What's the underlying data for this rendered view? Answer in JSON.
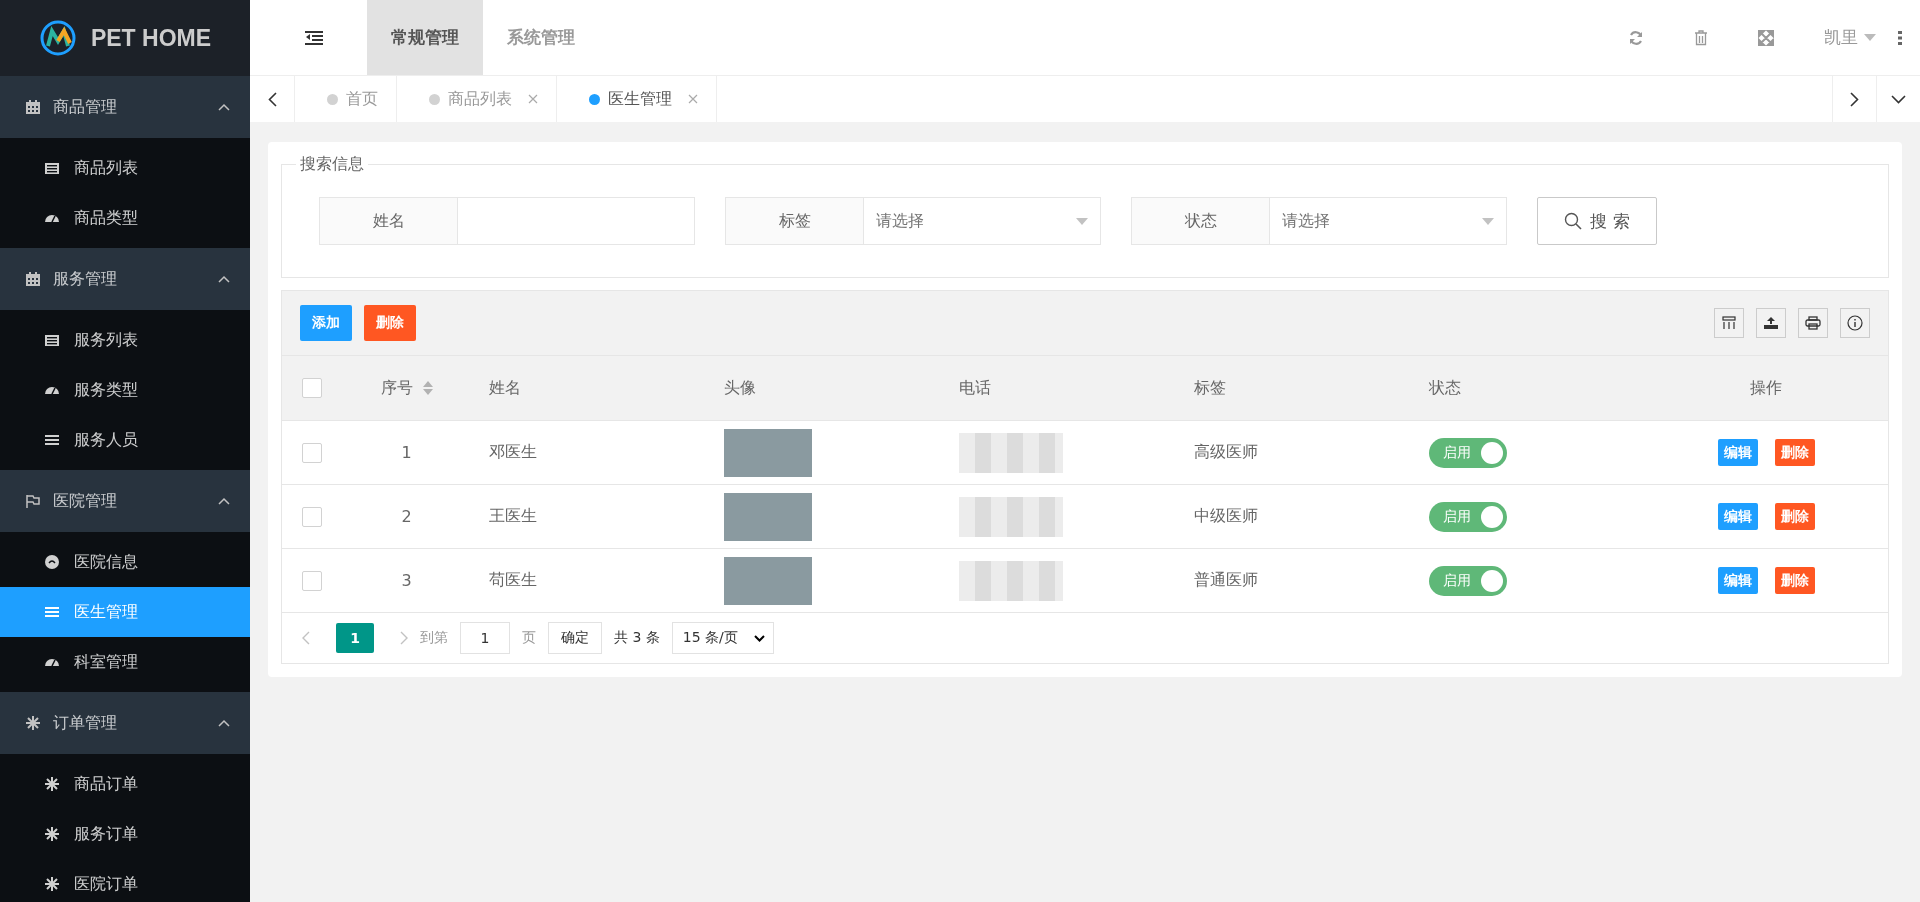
{
  "logo": {
    "title": "PET HOME"
  },
  "sidebar": {
    "groups": [
      {
        "label": "商品管理",
        "kind": "calendar",
        "expanded": true,
        "items": [
          {
            "label": "商品列表",
            "kind": "list",
            "selected": false
          },
          {
            "label": "商品类型",
            "kind": "gauge",
            "selected": false
          }
        ]
      },
      {
        "label": "服务管理",
        "kind": "calendar",
        "expanded": true,
        "items": [
          {
            "label": "服务列表",
            "kind": "list",
            "selected": false
          },
          {
            "label": "服务类型",
            "kind": "gauge",
            "selected": false
          },
          {
            "label": "服务人员",
            "kind": "bars",
            "selected": false
          }
        ]
      },
      {
        "label": "医院管理",
        "kind": "flag",
        "expanded": true,
        "items": [
          {
            "label": "医院信息",
            "kind": "dot",
            "selected": false
          },
          {
            "label": "医生管理",
            "kind": "bars",
            "selected": true
          },
          {
            "label": "科室管理",
            "kind": "gauge",
            "selected": false
          }
        ]
      },
      {
        "label": "订单管理",
        "kind": "snow",
        "expanded": true,
        "items": [
          {
            "label": "商品订单",
            "kind": "snow",
            "selected": false
          },
          {
            "label": "服务订单",
            "kind": "snow",
            "selected": false
          },
          {
            "label": "医院订单",
            "kind": "snow",
            "selected": false
          }
        ]
      }
    ]
  },
  "header": {
    "menu": [
      {
        "label": "常规管理",
        "selected": true
      },
      {
        "label": "系统管理",
        "selected": false
      }
    ],
    "user": "凯里"
  },
  "tabs": [
    {
      "label": "首页",
      "selected": false,
      "closable": false
    },
    {
      "label": "商品列表",
      "selected": false,
      "closable": true
    },
    {
      "label": "医生管理",
      "selected": true,
      "closable": true
    }
  ],
  "search": {
    "legend": "搜索信息",
    "fields": [
      {
        "label": "姓名",
        "kind": "text"
      },
      {
        "label": "标签",
        "kind": "select",
        "placeholder": "请选择"
      },
      {
        "label": "状态",
        "kind": "select",
        "placeholder": "请选择"
      }
    ],
    "button": "搜 索"
  },
  "toolbar": {
    "buttons": [
      {
        "label": "添加",
        "kind": "primary"
      },
      {
        "label": "删除",
        "kind": "danger"
      }
    ]
  },
  "table": {
    "header_checked": false,
    "columns": [
      {
        "label": "序号",
        "sortable": true
      },
      {
        "label": "姓名",
        "sortable": false
      },
      {
        "label": "头像",
        "sortable": false
      },
      {
        "label": "电话",
        "sortable": false
      },
      {
        "label": "标签",
        "sortable": false
      },
      {
        "label": "状态",
        "sortable": false
      },
      {
        "label": "操作",
        "sortable": false
      }
    ],
    "rows": [
      {
        "checked": false,
        "index": "1",
        "name": "邓医生",
        "label": "高级医师",
        "status": {
          "label": "启用",
          "on": true
        },
        "actions": [
          {
            "label": "编辑",
            "kind": "primary"
          },
          {
            "label": "删除",
            "kind": "danger"
          }
        ]
      },
      {
        "checked": false,
        "index": "2",
        "name": "王医生",
        "label": "中级医师",
        "status": {
          "label": "启用",
          "on": true
        },
        "actions": [
          {
            "label": "编辑",
            "kind": "primary"
          },
          {
            "label": "删除",
            "kind": "danger"
          }
        ]
      },
      {
        "checked": false,
        "index": "3",
        "name": "苟医生",
        "label": "普通医师",
        "status": {
          "label": "启用",
          "on": true
        },
        "actions": [
          {
            "label": "编辑",
            "kind": "primary"
          },
          {
            "label": "删除",
            "kind": "danger"
          }
        ]
      }
    ]
  },
  "pagination": {
    "pages": [
      {
        "label": "1",
        "selected": true
      }
    ],
    "goto_prefix": "到第",
    "goto_value": "1",
    "goto_suffix": "页",
    "confirm": "确定",
    "total": "共 3 条",
    "page_size": "15 条/页"
  }
}
